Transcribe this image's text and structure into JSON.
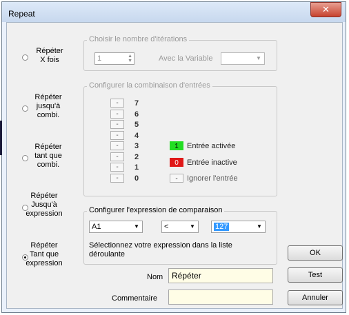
{
  "window": {
    "title": "Repeat",
    "close_glyph": "✕"
  },
  "modes": [
    {
      "label": "Répéter\nX fois",
      "selected": false
    },
    {
      "label": "Répéter\njusqu'à\ncombi.",
      "selected": false
    },
    {
      "label": "Répéter\ntant que\ncombi.",
      "selected": false
    },
    {
      "label": "Répéter\nJusqu'à\nexpression",
      "selected": false
    },
    {
      "label": "Répéter\nTant que\nexpression",
      "selected": true
    }
  ],
  "iterations": {
    "title": "Choisir le nombre d'itérations",
    "count_value": "1",
    "variable_label": "Avec la Variable",
    "variable_value": ""
  },
  "combination": {
    "title": "Configurer la combinaison d'entrées",
    "bits": [
      {
        "num": "7",
        "state": "-"
      },
      {
        "num": "6",
        "state": "-"
      },
      {
        "num": "5",
        "state": "-"
      },
      {
        "num": "4",
        "state": "-"
      },
      {
        "num": "3",
        "state": "-"
      },
      {
        "num": "2",
        "state": "-"
      },
      {
        "num": "1",
        "state": "-"
      },
      {
        "num": "0",
        "state": "-"
      }
    ],
    "legend": [
      {
        "symbol": "1",
        "label": "Entrée activée",
        "color": "#22dd22"
      },
      {
        "symbol": "0",
        "label": "Entrée inactive",
        "color": "#e01818"
      },
      {
        "symbol": "-",
        "label": "Ignorer l'entrée",
        "color": "#f7f7f7"
      }
    ]
  },
  "expression": {
    "title": "Configurer l'expression de comparaison",
    "operand1": "A1",
    "operator": "<",
    "operand2": "127",
    "hint": "Sélectionnez votre expression dans la liste\ndéroulante",
    "highlight_color": "#3399ff"
  },
  "form": {
    "name_label": "Nom",
    "name_value": "Répéter",
    "comment_label": "Commentaire",
    "comment_value": ""
  },
  "buttons": {
    "ok": "OK",
    "test": "Test",
    "cancel": "Annuler"
  }
}
